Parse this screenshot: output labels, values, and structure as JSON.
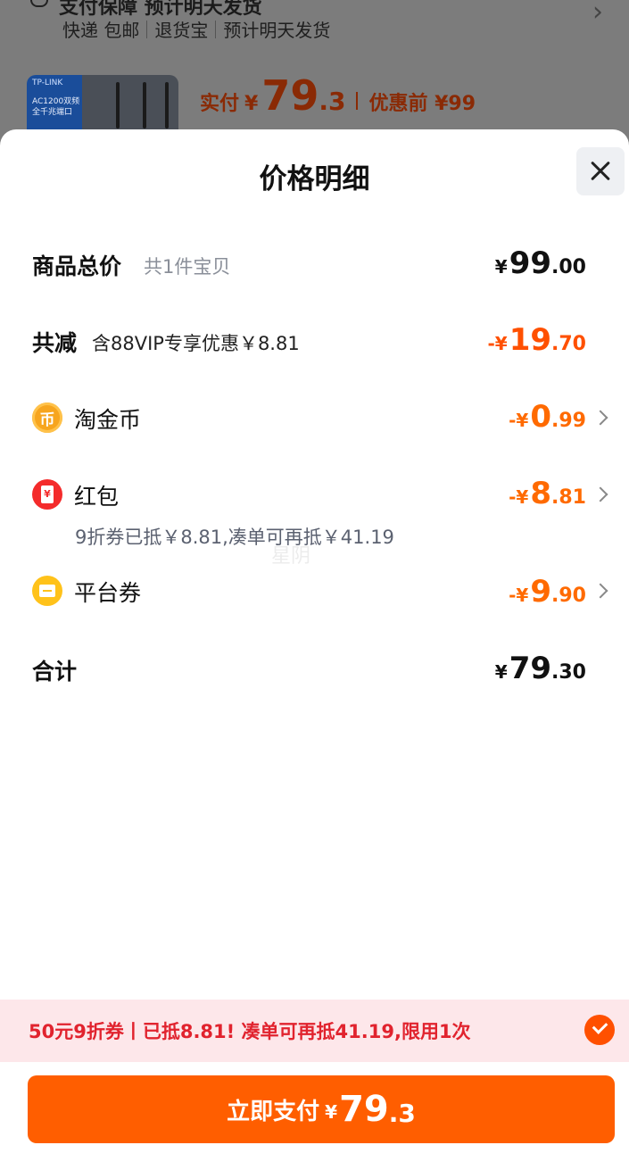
{
  "background": {
    "heading_partial": "支付保障 预计明天发货",
    "tags": [
      "快递 包邮",
      "退货宝",
      "预计明天发货"
    ],
    "product_image": {
      "brand": "TP-LINK",
      "model_line1": "AC1200双频",
      "model_line2": "全千兆端口"
    },
    "paid_label": "实付",
    "paid_currency": "¥",
    "paid_int": "79",
    "paid_dec": ".3",
    "before_label": "优惠前 ¥99"
  },
  "sheet": {
    "title": "价格明细"
  },
  "rows": {
    "total": {
      "label": "商品总价",
      "sub": "共1件宝贝",
      "currency": "¥",
      "int": "99",
      "dec": ".00"
    },
    "reduce": {
      "label": "共减",
      "sub": "含88VIP专享优惠￥8.81",
      "currency": "-¥",
      "int": "19",
      "dec": ".70"
    },
    "coin": {
      "icon_text": "币",
      "label": "淘金币",
      "currency": "-¥",
      "int": "0",
      "dec": ".99"
    },
    "redpacket": {
      "icon_text": "¥",
      "label": "红包",
      "note": "9折券已抵￥8.81,凑单可再抵￥41.19",
      "currency": "-¥",
      "int": "8",
      "dec": ".81"
    },
    "platform": {
      "label": "平台券",
      "currency": "-¥",
      "int": "9",
      "dec": ".90"
    },
    "sum": {
      "label": "合计",
      "currency": "¥",
      "int": "79",
      "dec": ".30"
    }
  },
  "watermark": "星阴",
  "promo": {
    "text": "50元9折券丨已抵8.81! 凑单可再抵41.19,限用1次"
  },
  "pay": {
    "label": "立即支付",
    "currency": "¥",
    "int": "79",
    "dec": ".3"
  },
  "colors": {
    "accent": "#ff5e00",
    "discount": "#ff5000",
    "promo_bg": "#fde7ea",
    "promo_text": "#e1232e"
  }
}
